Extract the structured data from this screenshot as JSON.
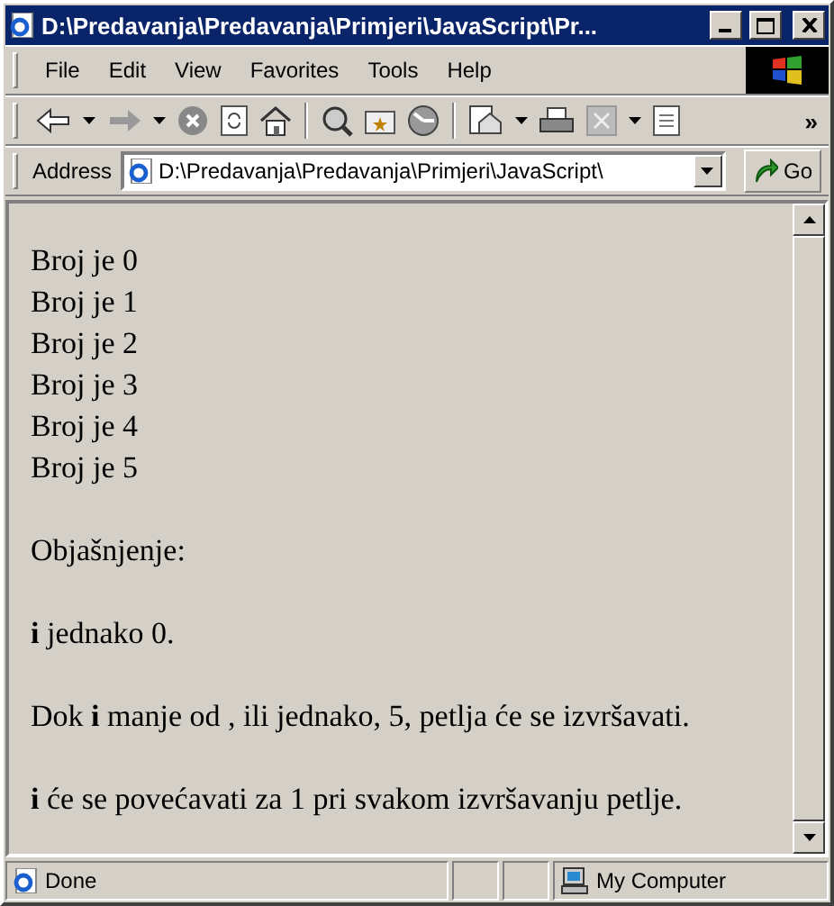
{
  "window": {
    "title": "D:\\Predavanja\\Predavanja\\Primjeri\\JavaScript\\Pr..."
  },
  "menu": [
    "File",
    "Edit",
    "View",
    "Favorites",
    "Tools",
    "Help"
  ],
  "toolbar": {
    "overflow": "»"
  },
  "address": {
    "label": "Address",
    "value": "D:\\Predavanja\\Predavanja\\Primjeri\\JavaScript\\",
    "go": "Go"
  },
  "content": [
    [
      "Broj je 0",
      "Broj je 1",
      "Broj je 2",
      "Broj je 3",
      "Broj je 4",
      "Broj je 5"
    ],
    [
      "Objašnjenje:"
    ],
    [
      "**i** jednako 0."
    ],
    [
      "Dok **i** manje od , ili jednako, 5, petlja će se izvršavati."
    ],
    [
      "**i** će se povećavati za 1 pri svakom izvršavanju petlje."
    ]
  ],
  "status_bar": {
    "text": "Done",
    "zone": "My Computer"
  }
}
